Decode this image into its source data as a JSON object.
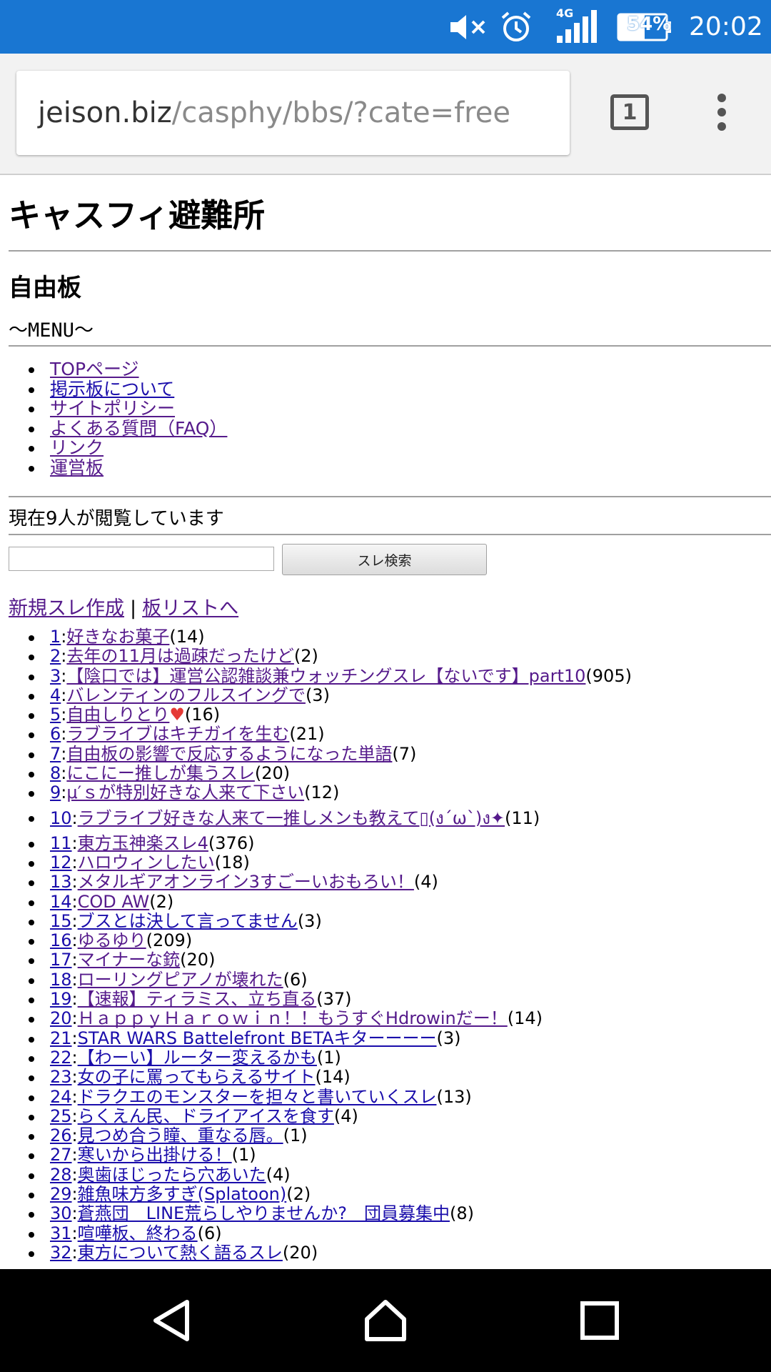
{
  "status_bar": {
    "network": "4G",
    "battery": "54%",
    "time": "20:02",
    "icons": [
      "mute-icon",
      "alarm-icon",
      "signal-icon",
      "battery-icon"
    ]
  },
  "browser": {
    "url_host": "jeison.biz",
    "url_path": "/casphy/bbs/?cate=free",
    "tab_count": "1"
  },
  "page": {
    "site_title": "キャスフィ避難所",
    "board_title": "自由板",
    "menu_label": "〜MENU〜",
    "nav": [
      {
        "label": "TOPページ"
      },
      {
        "label": "掲示板について"
      },
      {
        "label": "サイトポリシー"
      },
      {
        "label": "よくある質問（FAQ）"
      },
      {
        "label": "リンク"
      },
      {
        "label": "運営板"
      }
    ],
    "viewers": "現在9人が閲覧しています",
    "search_button": "スレ検索",
    "new_thread_link": "新規スレ作成",
    "separator": "|",
    "board_list_link": "板リストへ",
    "threads": [
      {
        "num": "1",
        "title": "好きなお菓子",
        "count": "(14)"
      },
      {
        "num": "2",
        "title": "去年の11月は過疎だったけど",
        "count": "(2)"
      },
      {
        "num": "3",
        "title": "【陰口では】運営公認雑談兼ウォッチングスレ【ないです】part10",
        "count": "(905)"
      },
      {
        "num": "4",
        "title": "バレンティンのフルスイングで",
        "count": "(3)"
      },
      {
        "num": "5",
        "title": "自由しりとり",
        "count": "(16)"
      },
      {
        "num": "6",
        "title": "ラブライブはキチガイを生む",
        "count": "(21)"
      },
      {
        "num": "7",
        "title": "自由板の影響で反応するようになった単語",
        "count": "(7)"
      },
      {
        "num": "8",
        "title": "にこにー推しが集うスレ",
        "count": "(20)"
      },
      {
        "num": "9",
        "title": "μ′ｓが特別好きな人来て下さい",
        "count": "(12)"
      },
      {
        "num": "10",
        "title": "ラブライブ好きな人来て一推しメンも教えて",
        "count": "(11)"
      },
      {
        "num": "11",
        "title": "東方玉神楽スレ4",
        "count": "(376)"
      },
      {
        "num": "12",
        "title": "ハロウィンしたい",
        "count": "(18)"
      },
      {
        "num": "13",
        "title": "メタルギアオンライン3すごーいおもろい！",
        "count": "(4)"
      },
      {
        "num": "14",
        "title": "COD AW",
        "count": "(2)"
      },
      {
        "num": "15",
        "title": "ブスとは決して言ってません",
        "count": "(3)"
      },
      {
        "num": "16",
        "title": "ゆるゆり",
        "count": "(209)"
      },
      {
        "num": "17",
        "title": "マイナーな銃",
        "count": "(20)"
      },
      {
        "num": "18",
        "title": "ローリングピアノが壊れた",
        "count": "(6)"
      },
      {
        "num": "19",
        "title": "【速報】ティラミス、立ち直る",
        "count": "(37)"
      },
      {
        "num": "20",
        "title": "ＨａｐｐｙＨａｒｏｗｉｎ！！もうすぐHdrowinだー！",
        "count": "(14)"
      },
      {
        "num": "21",
        "title": "STAR WARS Battelefront BETAキターーーー",
        "count": "(3)"
      },
      {
        "num": "22",
        "title": "【わーい】ルーター変えるかも",
        "count": "(1)"
      },
      {
        "num": "23",
        "title": "女の子に罵ってもらえるサイト",
        "count": "(14)"
      },
      {
        "num": "24",
        "title": "ドラクエのモンスターを担々と書いていくスレ",
        "count": "(13)"
      },
      {
        "num": "25",
        "title": "らくえん民、ドライアイスを食す",
        "count": "(4)"
      },
      {
        "num": "26",
        "title": "見つめ合う瞳、重なる唇。",
        "count": "(1)"
      },
      {
        "num": "27",
        "title": "寒いから出掛ける！",
        "count": "(1)"
      },
      {
        "num": "28",
        "title": "奥歯ほじったら穴あいた",
        "count": "(4)"
      },
      {
        "num": "29",
        "title": "雑魚味方多すぎ(Splatoon)",
        "count": "(2)"
      },
      {
        "num": "30",
        "title": "蒼燕団　LINE荒らしやりませんか?　団員募集中",
        "count": "(8)"
      },
      {
        "num": "31",
        "title": "喧嘩板、終わる",
        "count": "(6)"
      },
      {
        "num": "32",
        "title": "東方について熱く語るスレ",
        "count": "(20)"
      }
    ]
  },
  "nav_bar": {
    "buttons": [
      "back-icon",
      "home-icon",
      "recents-icon"
    ]
  }
}
